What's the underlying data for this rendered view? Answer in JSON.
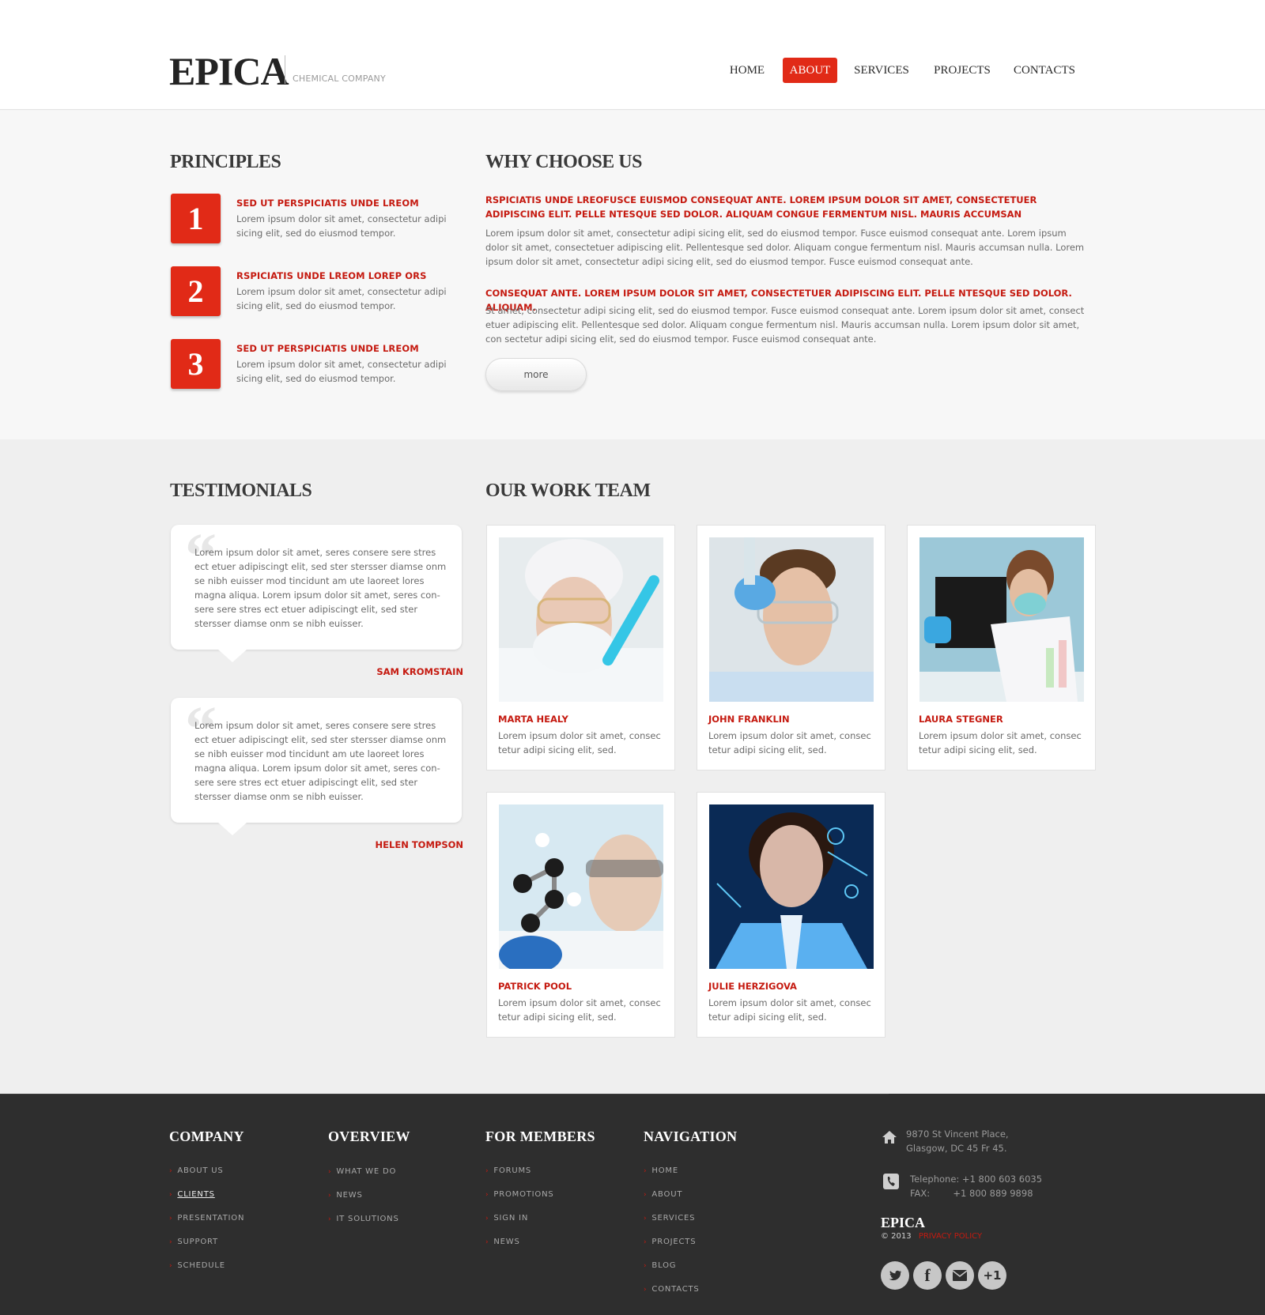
{
  "header": {
    "logo": "EPICA",
    "tagline": "CHEMICAL COMPANY",
    "nav": [
      {
        "label": "HOME"
      },
      {
        "label": "ABOUT",
        "active": true
      },
      {
        "label": "SERVICES"
      },
      {
        "label": "PROJECTS"
      },
      {
        "label": "CONTACTS"
      }
    ]
  },
  "principles": {
    "title": "PRINCIPLES",
    "items": [
      {
        "num": "1",
        "title": "SED UT PERSPICIATIS UNDE LREOM",
        "text": "Lorem ipsum dolor sit amet, consectetur adipi sicing elit, sed do eiusmod tempor."
      },
      {
        "num": "2",
        "title": "RSPICIATIS UNDE LREOM LOREP ORS",
        "text": "Lorem ipsum dolor sit amet, consectetur adipi sicing elit, sed do eiusmod tempor."
      },
      {
        "num": "3",
        "title": "SED UT PERSPICIATIS UNDE LREOM",
        "text": "Lorem ipsum dolor sit amet, consectetur adipi sicing elit, sed do eiusmod tempor."
      }
    ]
  },
  "why": {
    "title": "WHY CHOOSE US",
    "red1": "RSPICIATIS UNDE LREOFUSCE EUISMOD CONSEQUAT ANTE. LOREM IPSUM DOLOR SIT AMET, CONSECTETUER ADIPISCING ELIT. PELLE NTESQUE SED DOLOR. ALIQUAM CONGUE FERMENTUM NISL. MAURIS ACCUMSAN",
    "text1": "Lorem ipsum dolor sit amet, consectetur adipi sicing elit, sed do eiusmod tempor. Fusce euismod consequat ante. Lorem ipsum dolor sit amet, consectetuer adipiscing elit. Pellentesque sed dolor. Aliquam congue fermentum nisl. Mauris accumsan nulla. Lorem ipsum dolor sit amet, consectetur adipi sicing elit, sed do eiusmod tempor. Fusce euismod consequat ante.",
    "red2": "CONSEQUAT ANTE. LOREM IPSUM DOLOR SIT AMET, CONSECTETUER ADIPISCING ELIT. PELLE NTESQUE SED DOLOR. ALIQUAM.",
    "text2": "St amet, consectetur adipi sicing elit, sed do eiusmod tempor. Fusce euismod consequat ante. Lorem ipsum dolor sit amet, consect etuer adipiscing elit. Pellentesque sed dolor. Aliquam congue fermentum nisl. Mauris accumsan nulla. Lorem ipsum dolor sit amet, con sectetur adipi sicing elit, sed do eiusmod tempor. Fusce euismod consequat ante.",
    "more": "more"
  },
  "testimonials": {
    "title": "TESTIMONIALS",
    "items": [
      {
        "text": "Lorem ipsum dolor sit amet, seres consere sere stres ect etuer adipiscingt elit, sed ster stersser diamse onm se nibh euisser mod tincidunt am ute laoreet lores magna aliqua. Lorem ipsum dolor sit amet, seres con- sere sere stres ect etuer adipiscingt elit, sed ster stersser diamse onm se nibh euisser.",
        "author": "SAM KROMSTAIN"
      },
      {
        "text": "Lorem ipsum dolor sit amet, seres consere sere stres ect etuer adipiscingt elit, sed ster stersser diamse onm se nibh euisser mod tincidunt am ute laoreet lores magna aliqua. Lorem ipsum dolor sit amet, seres con- sere sere stres ect etuer adipiscingt elit, sed ster stersser diamse onm se nibh euisser.",
        "author": "HELEN TOMPSON"
      }
    ]
  },
  "team": {
    "title": "OUR WORK TEAM",
    "members": [
      {
        "name": "MARTA HEALY",
        "text": "Lorem ipsum dolor sit amet, consec tetur adipi sicing elit, sed."
      },
      {
        "name": "JOHN FRANKLIN",
        "text": "Lorem ipsum dolor sit amet, consec tetur adipi sicing elit, sed."
      },
      {
        "name": "LAURA STEGNER",
        "text": "Lorem ipsum dolor sit amet, consec tetur adipi sicing elit, sed."
      },
      {
        "name": "PATRICK POOL",
        "text": "Lorem ipsum dolor sit amet, consec tetur adipi sicing elit, sed."
      },
      {
        "name": "JULIE HERZIGOVA",
        "text": "Lorem ipsum dolor sit amet, consec tetur adipi sicing elit, sed."
      }
    ]
  },
  "footer": {
    "company": {
      "title": "COMPANY",
      "links": [
        "ABOUT US",
        "CLIENTS",
        "PRESENTATION",
        "SUPPORT",
        "SCHEDULE"
      ]
    },
    "overview": {
      "title": "OVERVIEW",
      "links": [
        "WHAT WE DO",
        "NEWS",
        "IT SOLUTIONS"
      ]
    },
    "members": {
      "title": "FOR MEMBERS",
      "links": [
        "FORUMS",
        "PROMOTIONS",
        "SIGN IN",
        "NEWS"
      ]
    },
    "navigation": {
      "title": "NAVIGATION",
      "links": [
        "HOME",
        "ABOUT",
        "SERVICES",
        "PROJECTS",
        "BLOG",
        "CONTACTS"
      ]
    },
    "address1": "9870 St Vincent Place,",
    "address2": "Glasgow, DC 45 Fr 45.",
    "telephone": "Telephone:  +1 800 603 6035",
    "fax": "FAX:        +1 800 889 9898",
    "logo": "EPICA",
    "copyright": "© 2013",
    "privacy": "PRIVACY POLICY",
    "social": [
      "twitter-icon",
      "facebook-icon",
      "mail-icon",
      "google-plus-icon"
    ],
    "plus_one": "+1"
  },
  "colors": {
    "accent": "#e12a17",
    "accent_text": "#c51a10",
    "footer_bg": "#2e2e2e"
  }
}
